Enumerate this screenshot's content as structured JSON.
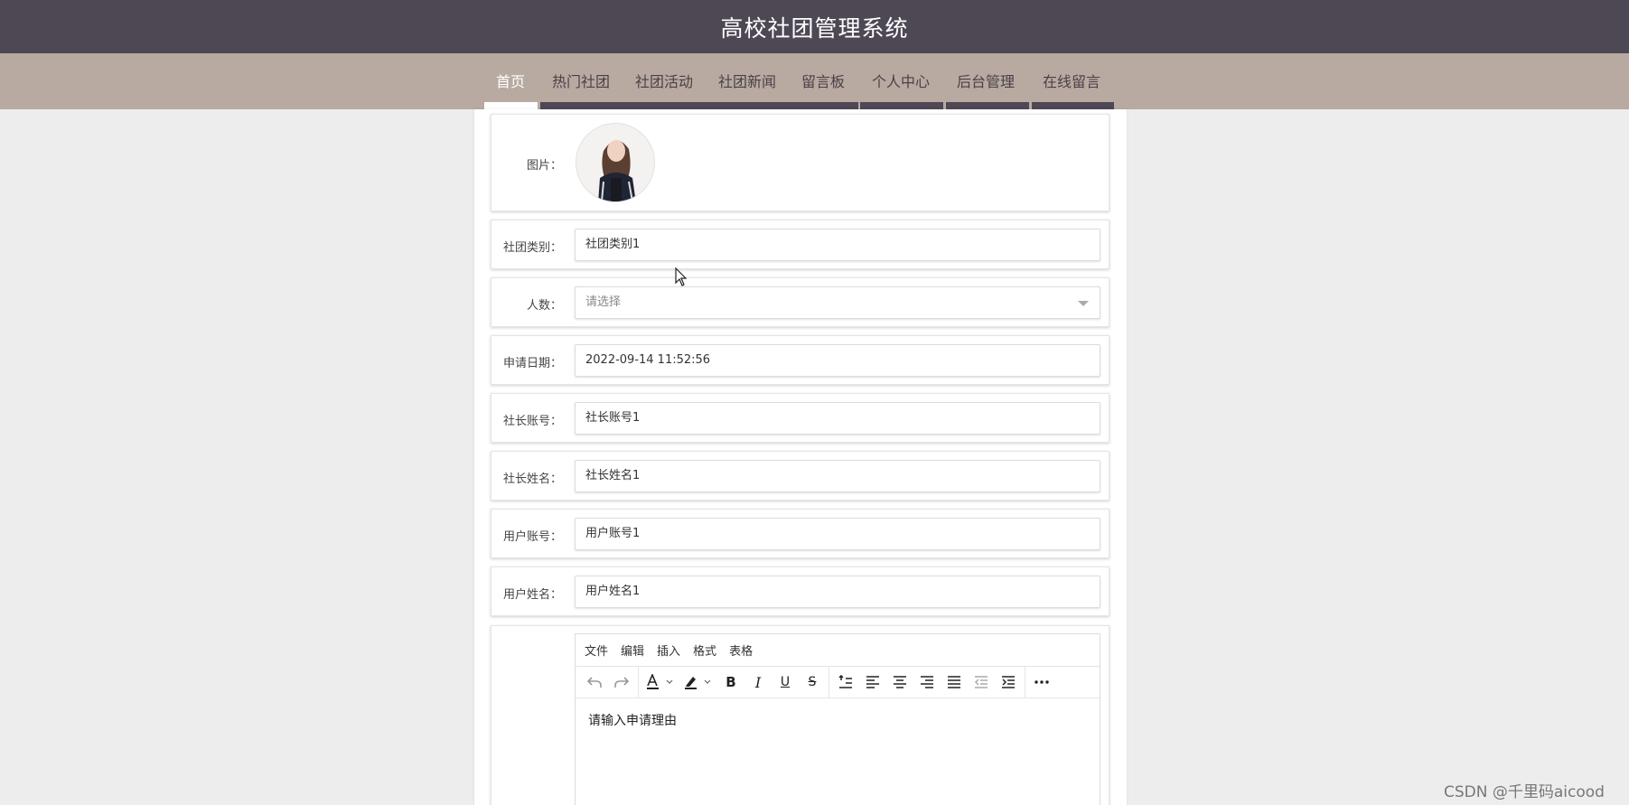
{
  "header": {
    "title": "高校社团管理系统"
  },
  "nav": {
    "items": [
      {
        "label": "首页",
        "active": true
      },
      {
        "label": "热门社团"
      },
      {
        "label": "社团活动"
      },
      {
        "label": "社团新闻"
      },
      {
        "label": "留言板"
      },
      {
        "label": "个人中心"
      },
      {
        "label": "后台管理"
      },
      {
        "label": "在线留言"
      }
    ]
  },
  "form": {
    "image": {
      "label": "图片：",
      "icon": "avatar-photo"
    },
    "category": {
      "label": "社团类别：",
      "value": "社团类别1"
    },
    "members": {
      "label": "人数：",
      "placeholder": "请选择"
    },
    "apply_date": {
      "label": "申请日期：",
      "value": "2022-09-14 11:52:56"
    },
    "leader_account": {
      "label": "社长账号：",
      "value": "社长账号1"
    },
    "leader_name": {
      "label": "社长姓名：",
      "value": "社长姓名1"
    },
    "user_account": {
      "label": "用户账号：",
      "value": "用户账号1"
    },
    "user_name": {
      "label": "用户姓名：",
      "value": "用户姓名1"
    },
    "editor": {
      "menus": [
        "文件",
        "编辑",
        "插入",
        "格式",
        "表格"
      ],
      "toolbar_icons": [
        "undo-icon",
        "redo-icon",
        "text-color-icon",
        "highlight-icon",
        "bold-icon",
        "italic-icon",
        "underline-icon",
        "strikethrough-icon",
        "line-height-icon",
        "align-left-icon",
        "align-center-icon",
        "align-right-icon",
        "align-justify-icon",
        "outdent-icon",
        "indent-icon",
        "more-icon"
      ],
      "content": "请输入申请理由"
    }
  },
  "colors": {
    "header_bg": "#4e4855",
    "nav_bg": "#b8aaa0",
    "page_bg": "#ededed"
  },
  "watermark": "CSDN @千里码aicood"
}
